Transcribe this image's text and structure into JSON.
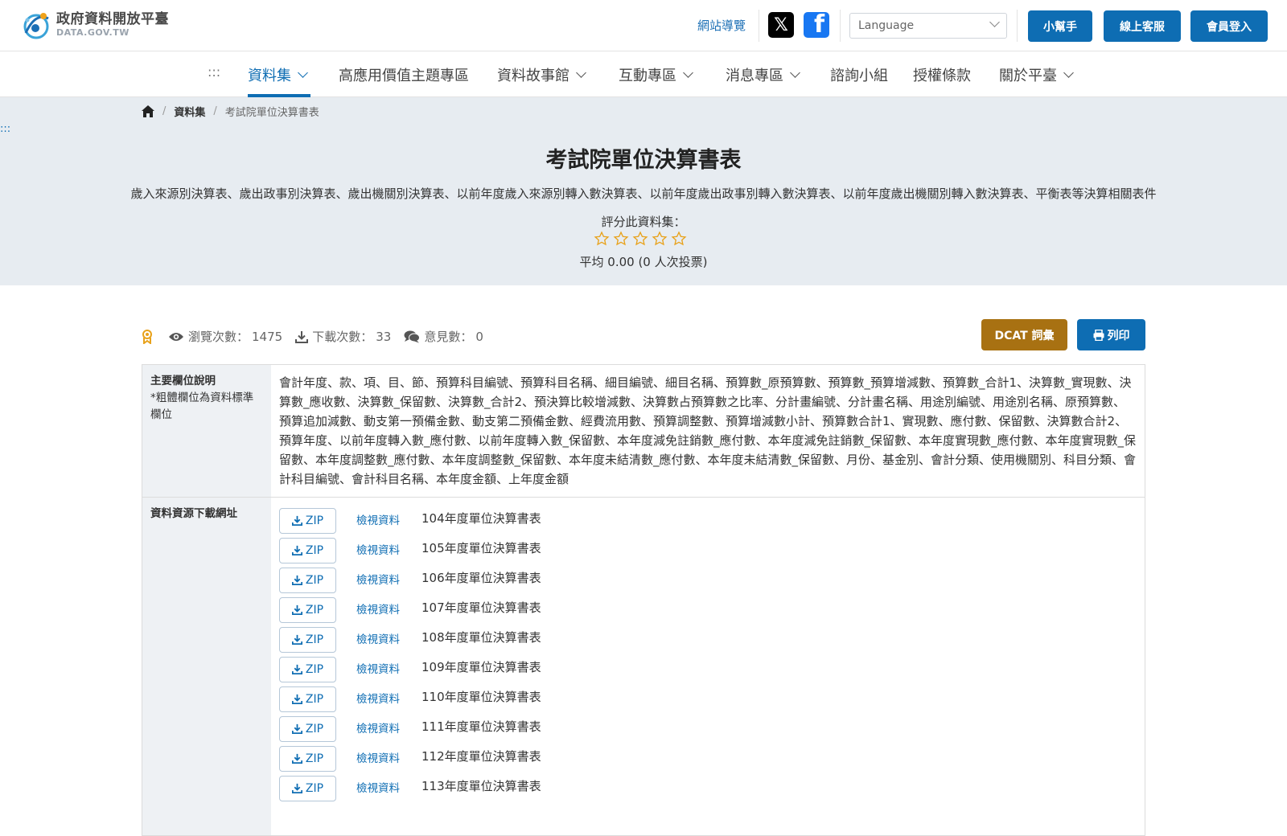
{
  "header": {
    "logo_title": "政府資料開放平臺",
    "logo_sub": "DATA.GOV.TW",
    "site_map": "網站導覽",
    "language_placeholder": "Language",
    "helper": "小幫手",
    "support": "線上客服",
    "login": "會員登入",
    "colors": {
      "primary": "#0e6db3",
      "gold": "#a87112",
      "hero_bg": "#e7ecf1"
    }
  },
  "nav": {
    "accesskey": ":::",
    "items": [
      {
        "label": "資料集",
        "dropdown": true,
        "active": true
      },
      {
        "label": "高應用價值主題專區",
        "dropdown": false
      },
      {
        "label": "資料故事館",
        "dropdown": true
      },
      {
        "label": "互動專區",
        "dropdown": true
      },
      {
        "label": "消息專區",
        "dropdown": true
      },
      {
        "label": "諮詢小組",
        "dropdown": false
      },
      {
        "label": "授權條款",
        "dropdown": false
      },
      {
        "label": "關於平臺",
        "dropdown": true
      }
    ]
  },
  "hero": {
    "breadcrumb": {
      "level1": "資料集",
      "current": "考試院單位決算書表"
    },
    "side_accesskey": ":::",
    "title": "考試院單位決算書表",
    "description": "歲入來源別決算表、歲出政事別決算表、歲出機關別決算表、以前年度歲入來源別轉入數決算表、以前年度歲出政事別轉入數決算表、以前年度歲出機關別轉入數決算表、平衡表等決算相關表件",
    "rate_label": "評分此資料集：",
    "rating": {
      "stars_total": 5,
      "stars_filled": 0
    },
    "average": "平均 0.00 (0 人次投票)"
  },
  "stats": {
    "views_label": "瀏覽次數：",
    "views": "1475",
    "downloads_label": "下載次數：",
    "downloads": "33",
    "comments_label": "意見數：",
    "comments": "0"
  },
  "actions": {
    "dcat": "DCAT 詞彙",
    "print": "列印"
  },
  "table": {
    "fields_header": "主要欄位說明",
    "fields_note": "*粗體欄位為資料標準欄位",
    "fields_text": "會計年度、款、項、目、節、預算科目編號、預算科目名稱、細目編號、細目名稱、預算數_原預算數、預算數_預算增減數、預算數_合計1、決算數_實現數、決算數_應收數、決算數_保留數、決算數_合計2、預決算比較增減數、決算數占預算數之比率、分計畫編號、分計畫名稱、用途別編號、用途別名稱、原預算數、預算追加減數、動支第一預備金數、動支第二預備金數、經費流用數、預算調整數、預算增減數小計、預算數合計1、實現數、應付數、保留數、決算數合計2、預算年度、以前年度轉入數_應付數、以前年度轉入數_保留數、本年度減免註銷數_應付數、本年度減免註銷數_保留數、本年度實現數_應付數、本年度實現數_保留數、本年度調整數_應付數、本年度調整數_保留數、本年度未結清數_應付數、本年度未結清數_保留數、月份、基金別、會計分類、使用機關別、科目分類、會計科目編號、會計科目名稱、本年度金額、上年度金額",
    "resources_header": "資料資源下載網址",
    "zip_label": "ZIP",
    "view_label": "檢視資料",
    "resources": [
      "104年度單位決算書表",
      "105年度單位決算書表",
      "106年度單位決算書表",
      "107年度單位決算書表",
      "108年度單位決算書表",
      "109年度單位決算書表",
      "110年度單位決算書表",
      "111年度單位決算書表",
      "112年度單位決算書表",
      "113年度單位決算書表"
    ]
  }
}
